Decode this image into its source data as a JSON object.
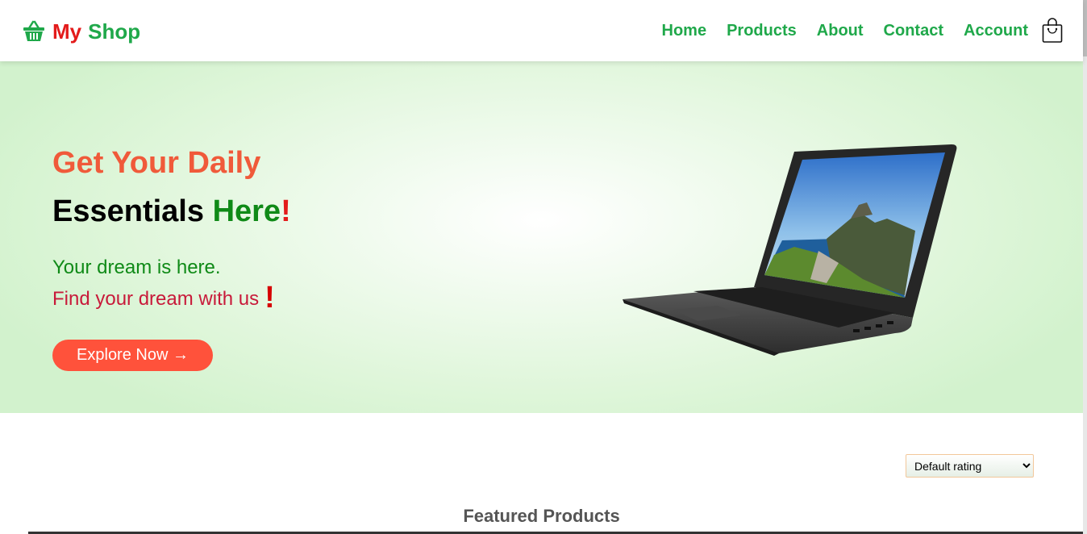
{
  "brand": {
    "my": "My",
    "shop": "Shop",
    "icon": "basket-icon"
  },
  "nav": {
    "items": [
      {
        "label": "Home"
      },
      {
        "label": "Products"
      },
      {
        "label": "About"
      },
      {
        "label": "Contact"
      },
      {
        "label": "Account"
      }
    ],
    "cart_icon": "shopping-bag-icon"
  },
  "hero": {
    "headline1": "Get Your Daily",
    "headline2_a": "Essentials ",
    "headline2_b": "Here",
    "headline2_c": "!",
    "sub1": "Your dream is here.",
    "sub2": "Find your dream with us",
    "sub2_excl": "!",
    "cta_label": "Explore Now →",
    "image": "laptop-image"
  },
  "sort": {
    "selected": "Default rating"
  },
  "featured": {
    "title": "Featured Products"
  },
  "colors": {
    "accent_green": "#1fa84a",
    "brand_red": "#e31b1b",
    "cta": "#ff523b",
    "headline_orange": "#f05a3a"
  }
}
